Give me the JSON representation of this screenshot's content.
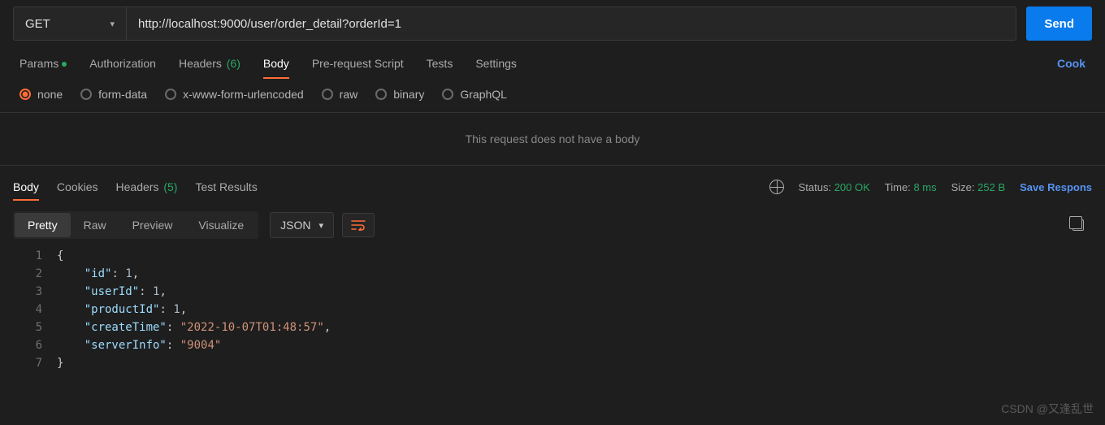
{
  "request": {
    "method": "GET",
    "url": "http://localhost:9000/user/order_detail?orderId=1",
    "send_label": "Send"
  },
  "req_tabs": {
    "params": "Params",
    "authorization": "Authorization",
    "headers": "Headers",
    "headers_count": "(6)",
    "body": "Body",
    "prerequest": "Pre-request Script",
    "tests": "Tests",
    "settings": "Settings",
    "cookies_link": "Cook"
  },
  "body_types": {
    "none": "none",
    "form_data": "form-data",
    "xwww": "x-www-form-urlencoded",
    "raw": "raw",
    "binary": "binary",
    "graphql": "GraphQL"
  },
  "no_body_msg": "This request does not have a body",
  "resp_tabs": {
    "body": "Body",
    "cookies": "Cookies",
    "headers": "Headers",
    "headers_count": "(5)",
    "test_results": "Test Results"
  },
  "resp_meta": {
    "status_label": "Status:",
    "status_value": "200 OK",
    "time_label": "Time:",
    "time_value": "8 ms",
    "size_label": "Size:",
    "size_value": "252 B",
    "save_label": "Save Respons"
  },
  "view": {
    "pretty": "Pretty",
    "raw": "Raw",
    "preview": "Preview",
    "visualize": "Visualize",
    "format": "JSON"
  },
  "response_json": {
    "id": 1,
    "userId": 1,
    "productId": 1,
    "createTime": "2022-10-07T01:48:57",
    "serverInfo": "9004"
  },
  "watermark": "CSDN @又逢乱世"
}
